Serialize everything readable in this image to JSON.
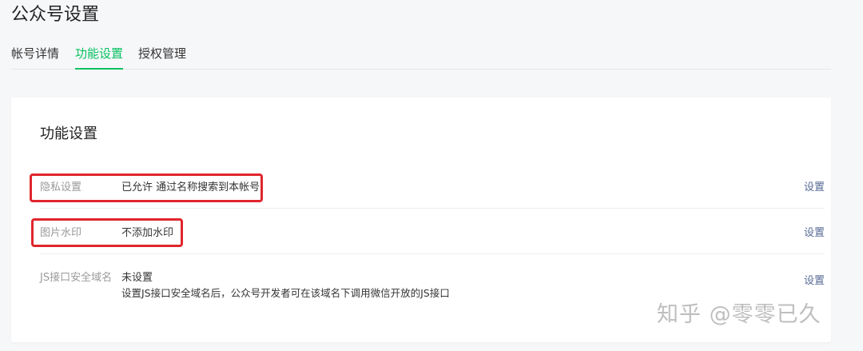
{
  "header": {
    "title": "公众号设置"
  },
  "tabs": [
    {
      "label": "帐号详情",
      "active": false
    },
    {
      "label": "功能设置",
      "active": true
    },
    {
      "label": "授权管理",
      "active": false
    }
  ],
  "colors": {
    "accent": "#07c160",
    "link": "#576b95",
    "highlight": "#e0262d"
  },
  "section": {
    "title": "功能设置",
    "rows": [
      {
        "label": "隐私设置",
        "value": "已允许 通过名称搜索到本帐号",
        "action": "设置"
      },
      {
        "label": "图片水印",
        "value": "不添加水印",
        "action": "设置"
      },
      {
        "label": "JS接口安全域名",
        "value": "未设置",
        "description": "设置JS接口安全域名后，公众号开发者可在该域名下调用微信开放的JS接口",
        "action": "设置"
      }
    ]
  },
  "watermark": {
    "text": "知乎 @零零已久"
  }
}
